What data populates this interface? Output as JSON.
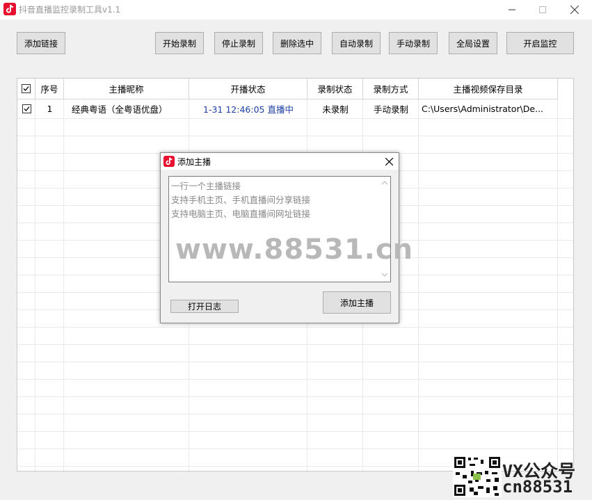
{
  "window": {
    "title": "抖音直播监控录制工具v1.1"
  },
  "toolbar": {
    "add_link": "添加链接",
    "start_record": "开始录制",
    "stop_record": "停止录制",
    "delete_selected": "删除选中",
    "auto_record": "自动录制",
    "manual_record": "手动录制",
    "global_settings": "全局设置",
    "start_monitor": "开启监控"
  },
  "table": {
    "columns": [
      "序号",
      "主播昵称",
      "开播状态",
      "录制状态",
      "录制方式",
      "主播视频保存目录"
    ],
    "rows": [
      {
        "checked": true,
        "index": "1",
        "nickname": "经典粤语（全粤语优盘）",
        "live_status": "1-31 12:46:05 直播中",
        "record_status": "未录制",
        "record_mode": "手动录制",
        "save_dir": "C:\\Users\\Administrator\\De..."
      }
    ]
  },
  "dialog": {
    "title": "添加主播",
    "hints": [
      "一行一个主播链接",
      "支持手机主页、手机直播间分享链接",
      "支持电脑主页、电脑直播间网址链接"
    ],
    "open_log": "打开日志",
    "add_streamer": "添加主播"
  },
  "watermark": {
    "site": "www.88531.cn",
    "vx": "VX公众号",
    "cn": "cn88531"
  },
  "colors": {
    "live_status": "#1c3fa8",
    "brand": "#e8102e"
  }
}
